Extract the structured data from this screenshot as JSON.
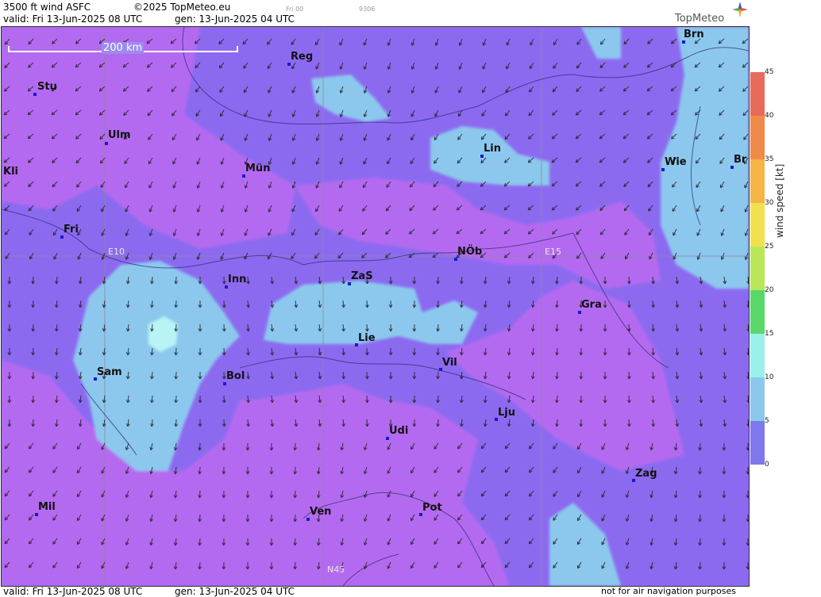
{
  "header": {
    "product": "3500 ft wind ASFC",
    "copyright": "©2025 TopMeteo.eu",
    "run_hint": "Fri 00",
    "code": "9306",
    "valid": "valid:  Fri  13-Jun-2025  08 UTC",
    "generated": "gen: 13-Jun-2025 04 UTC"
  },
  "logo": {
    "name": "TopMeteo",
    "icon": "compass-star-icon"
  },
  "scale_bar": {
    "label": "200 km"
  },
  "grid_labels": [
    "E10",
    "E15",
    "N45"
  ],
  "cities": [
    {
      "code": "Stu"
    },
    {
      "code": "Reg"
    },
    {
      "code": "Ulm"
    },
    {
      "code": "Kli"
    },
    {
      "code": "Mün"
    },
    {
      "code": "Lin"
    },
    {
      "code": "Wie"
    },
    {
      "code": "Br"
    },
    {
      "code": "Brn"
    },
    {
      "code": "Fri"
    },
    {
      "code": "NÖb"
    },
    {
      "code": "Inn"
    },
    {
      "code": "ZaS"
    },
    {
      "code": "Gra"
    },
    {
      "code": "Lie"
    },
    {
      "code": "Vil"
    },
    {
      "code": "Sam"
    },
    {
      "code": "Bol"
    },
    {
      "code": "Lju"
    },
    {
      "code": "Udi"
    },
    {
      "code": "Zag"
    },
    {
      "code": "Mil"
    },
    {
      "code": "Ven"
    },
    {
      "code": "Pot"
    }
  ],
  "legend": {
    "title": "wind speed [kt]",
    "ticks": [
      "45",
      "40",
      "35",
      "30",
      "25",
      "20",
      "15",
      "10",
      "5",
      "0"
    ],
    "colors": [
      "#e86a5a",
      "#f08a48",
      "#f5b548",
      "#f2e050",
      "#b8e85a",
      "#58d868",
      "#9cf0ec",
      "#8cc8ee",
      "#7e78ec",
      "#b46af0"
    ]
  },
  "footer": {
    "valid": "valid:  Fri  13-Jun-2025  08 UTC",
    "generated": "gen: 13-Jun-2025 04 UTC",
    "disclaimer": "not for air navigation purposes"
  },
  "colors": {
    "band_0_5": "#b46af0",
    "band_5_10": "#8c6af0",
    "band_10_15": "#8cc8ee",
    "band_15_20": "#b8f4f4"
  }
}
